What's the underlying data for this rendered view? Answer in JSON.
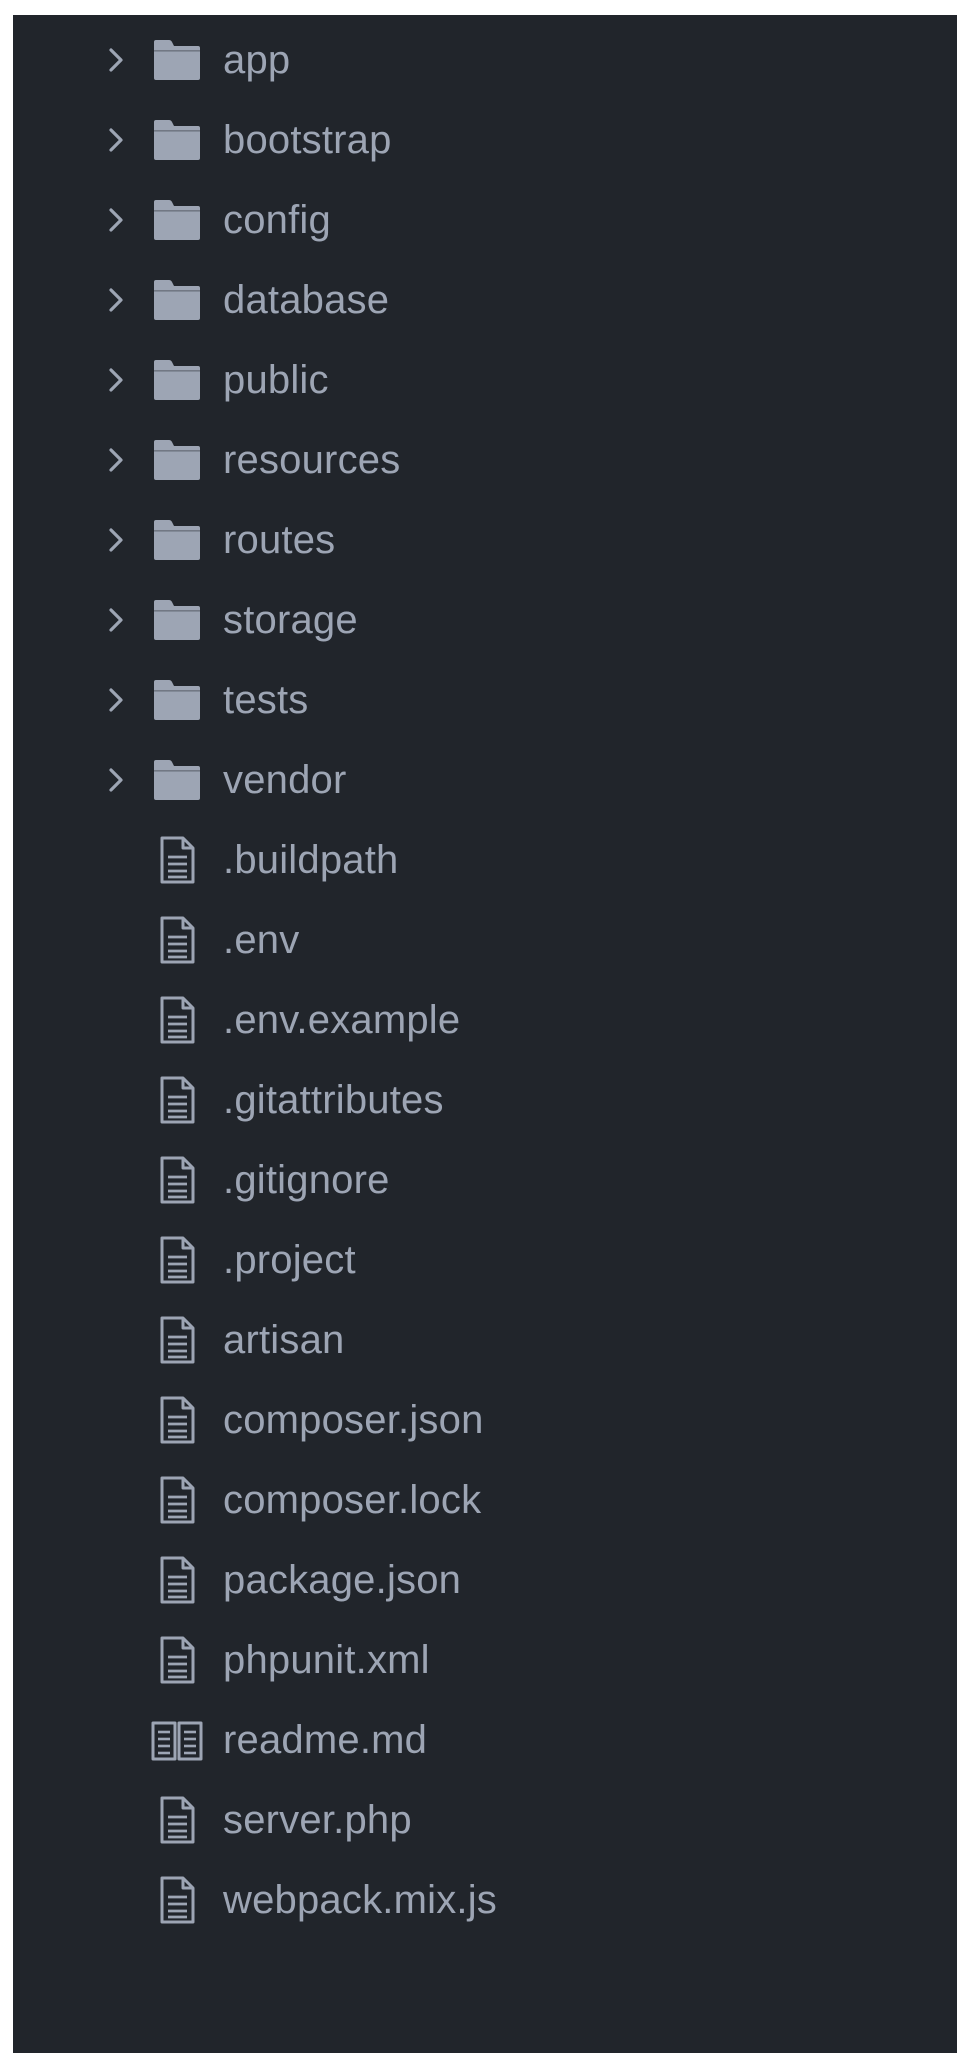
{
  "colors": {
    "panel_background": "#21252b",
    "label": "#9da5b4",
    "folder_icon": "#9da5b4",
    "file_icon": "#9da5b4"
  },
  "tree": {
    "items": [
      {
        "label": "app",
        "kind": "folder",
        "icon": "folder-icon",
        "expanded": false
      },
      {
        "label": "bootstrap",
        "kind": "folder",
        "icon": "folder-icon",
        "expanded": false
      },
      {
        "label": "config",
        "kind": "folder",
        "icon": "folder-icon",
        "expanded": false
      },
      {
        "label": "database",
        "kind": "folder",
        "icon": "folder-icon",
        "expanded": false
      },
      {
        "label": "public",
        "kind": "folder",
        "icon": "folder-icon",
        "expanded": false
      },
      {
        "label": "resources",
        "kind": "folder",
        "icon": "folder-icon",
        "expanded": false
      },
      {
        "label": "routes",
        "kind": "folder",
        "icon": "folder-icon",
        "expanded": false
      },
      {
        "label": "storage",
        "kind": "folder",
        "icon": "folder-icon",
        "expanded": false
      },
      {
        "label": "tests",
        "kind": "folder",
        "icon": "folder-icon",
        "expanded": false
      },
      {
        "label": "vendor",
        "kind": "folder",
        "icon": "folder-icon",
        "expanded": false
      },
      {
        "label": ".buildpath",
        "kind": "file",
        "icon": "file-text-icon"
      },
      {
        "label": ".env",
        "kind": "file",
        "icon": "file-text-icon"
      },
      {
        "label": ".env.example",
        "kind": "file",
        "icon": "file-text-icon"
      },
      {
        "label": ".gitattributes",
        "kind": "file",
        "icon": "file-text-icon"
      },
      {
        "label": ".gitignore",
        "kind": "file",
        "icon": "file-text-icon"
      },
      {
        "label": ".project",
        "kind": "file",
        "icon": "file-text-icon"
      },
      {
        "label": "artisan",
        "kind": "file",
        "icon": "file-text-icon"
      },
      {
        "label": "composer.json",
        "kind": "file",
        "icon": "file-text-icon"
      },
      {
        "label": "composer.lock",
        "kind": "file",
        "icon": "file-text-icon"
      },
      {
        "label": "package.json",
        "kind": "file",
        "icon": "file-text-icon"
      },
      {
        "label": "phpunit.xml",
        "kind": "file",
        "icon": "file-text-icon"
      },
      {
        "label": "readme.md",
        "kind": "file",
        "icon": "book-icon"
      },
      {
        "label": "server.php",
        "kind": "file",
        "icon": "file-text-icon"
      },
      {
        "label": "webpack.mix.js",
        "kind": "file",
        "icon": "file-text-icon"
      }
    ]
  }
}
